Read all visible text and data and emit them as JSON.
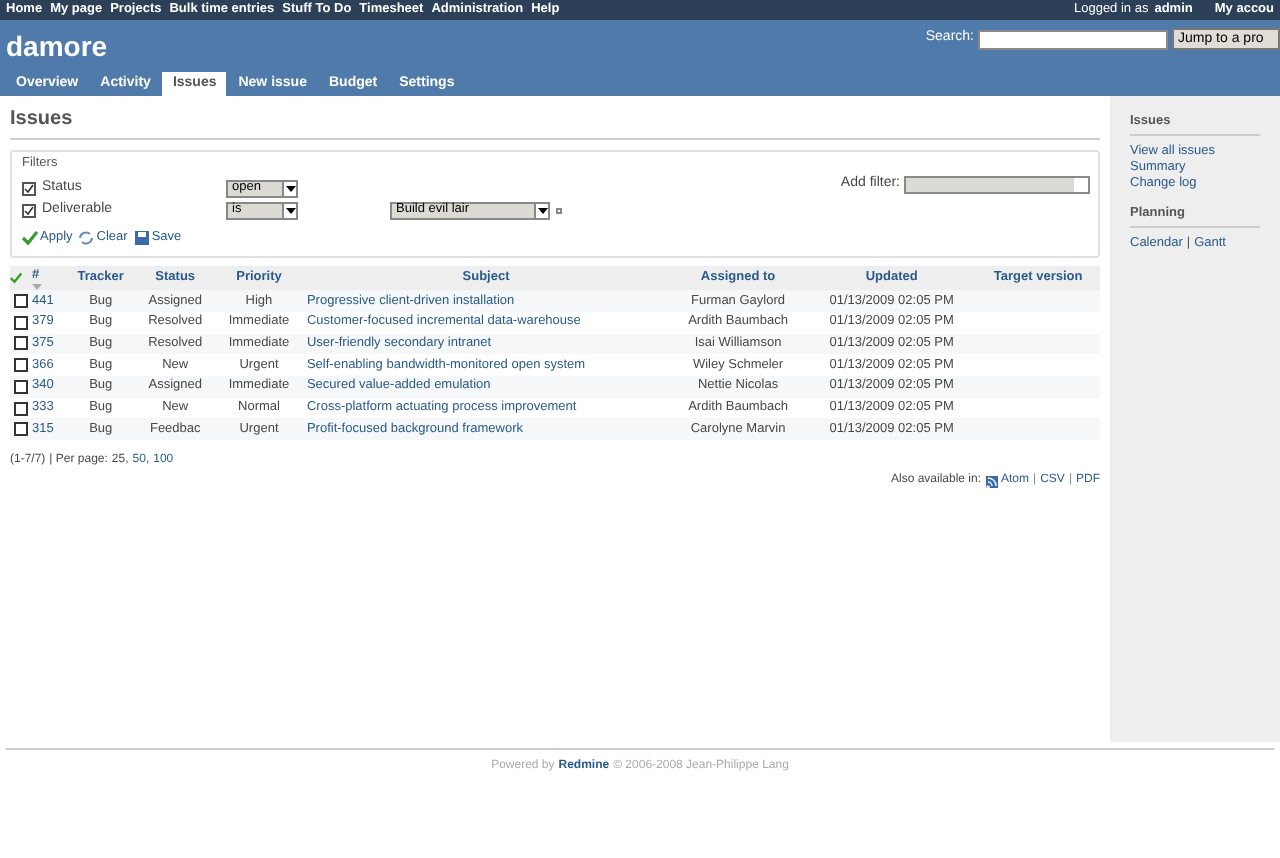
{
  "top_menu": [
    "Home",
    "My page",
    "Projects",
    "Bulk time entries",
    "Stuff To Do",
    "Timesheet",
    "Administration",
    "Help"
  ],
  "account": {
    "logged_in_label": "Logged in as",
    "user": "admin",
    "my_account": "My accou"
  },
  "header": {
    "project": "damore",
    "search_label": "Search:",
    "jump_label": "Jump to a pro"
  },
  "tabs": [
    {
      "label": "Overview",
      "selected": false
    },
    {
      "label": "Activity",
      "selected": false
    },
    {
      "label": "Issues",
      "selected": true
    },
    {
      "label": "New issue",
      "selected": false
    },
    {
      "label": "Budget",
      "selected": false
    },
    {
      "label": "Settings",
      "selected": false
    }
  ],
  "page_title": "Issues",
  "filters": {
    "legend": "Filters",
    "add_filter_label": "Add filter:",
    "rows": [
      {
        "label": "Status",
        "checked": true,
        "operator": "open"
      },
      {
        "label": "Deliverable",
        "checked": true,
        "operator": "is",
        "value": "Build evil lair"
      }
    ],
    "actions": [
      "Apply",
      "Clear",
      "Save"
    ]
  },
  "table": {
    "columns": [
      "#",
      "Tracker",
      "Status",
      "Priority",
      "Subject",
      "Assigned to",
      "Updated",
      "Target version"
    ],
    "rows": [
      {
        "checked": false,
        "id": "441",
        "tracker": "Bug",
        "status": "Assigned",
        "priority": "High",
        "subject": "Progressive client-driven installation",
        "assigned_to": "Furman Gaylord",
        "updated": "01/13/2009 02:05 PM"
      },
      {
        "checked": false,
        "id": "379",
        "tracker": "Bug",
        "status": "Resolved",
        "priority": "Immediate",
        "subject": "Customer-focused incremental data-warehouse",
        "assigned_to": "Ardith Baumbach",
        "updated": "01/13/2009 02:05 PM"
      },
      {
        "checked": false,
        "id": "375",
        "tracker": "Bug",
        "status": "Resolved",
        "priority": "Immediate",
        "subject": "User-friendly secondary intranet",
        "assigned_to": "Isai Williamson",
        "updated": "01/13/2009 02:05 PM"
      },
      {
        "checked": false,
        "id": "366",
        "tracker": "Bug",
        "status": "New",
        "priority": "Urgent",
        "subject": "Self-enabling bandwidth-monitored open system",
        "assigned_to": "Wiley Schmeler",
        "updated": "01/13/2009 02:05 PM"
      },
      {
        "checked": false,
        "id": "340",
        "tracker": "Bug",
        "status": "Assigned",
        "priority": "Immediate",
        "subject": "Secured value-added emulation",
        "assigned_to": "Nettie Nicolas",
        "updated": "01/13/2009 02:05 PM"
      },
      {
        "checked": false,
        "id": "333",
        "tracker": "Bug",
        "status": "New",
        "priority": "Normal",
        "subject": "Cross-platform actuating process improvement",
        "assigned_to": "Ardith Baumbach",
        "updated": "01/13/2009 02:05 PM"
      },
      {
        "checked": false,
        "id": "315",
        "tracker": "Bug",
        "status": "Feedbac",
        "priority": "Urgent",
        "subject": "Profit-focused background framework",
        "assigned_to": "Carolyne Marvin",
        "updated": "01/13/2009 02:05 PM"
      }
    ]
  },
  "pagination": {
    "count": "(1-7/7)",
    "per_page_label": "| Per page:",
    "current": "25,",
    "options": [
      "50,",
      "100"
    ]
  },
  "other_formats": {
    "label": "Also available in:",
    "links": [
      "Atom",
      "CSV",
      "PDF"
    ],
    "separators": [
      "|",
      "|"
    ]
  },
  "sidebar": [
    {
      "heading": "Issues",
      "links": [
        [
          "View all issues"
        ],
        [
          "Summary"
        ],
        [
          "Change log"
        ]
      ]
    },
    {
      "heading": "Planning",
      "links": [
        [
          "Calendar",
          "Gantt"
        ]
      ],
      "separators": [
        "|"
      ]
    }
  ],
  "footer": {
    "before": "Powered by",
    "link": "Redmine",
    "after": "© 2006-2008 Jean-Philippe Lang"
  }
}
